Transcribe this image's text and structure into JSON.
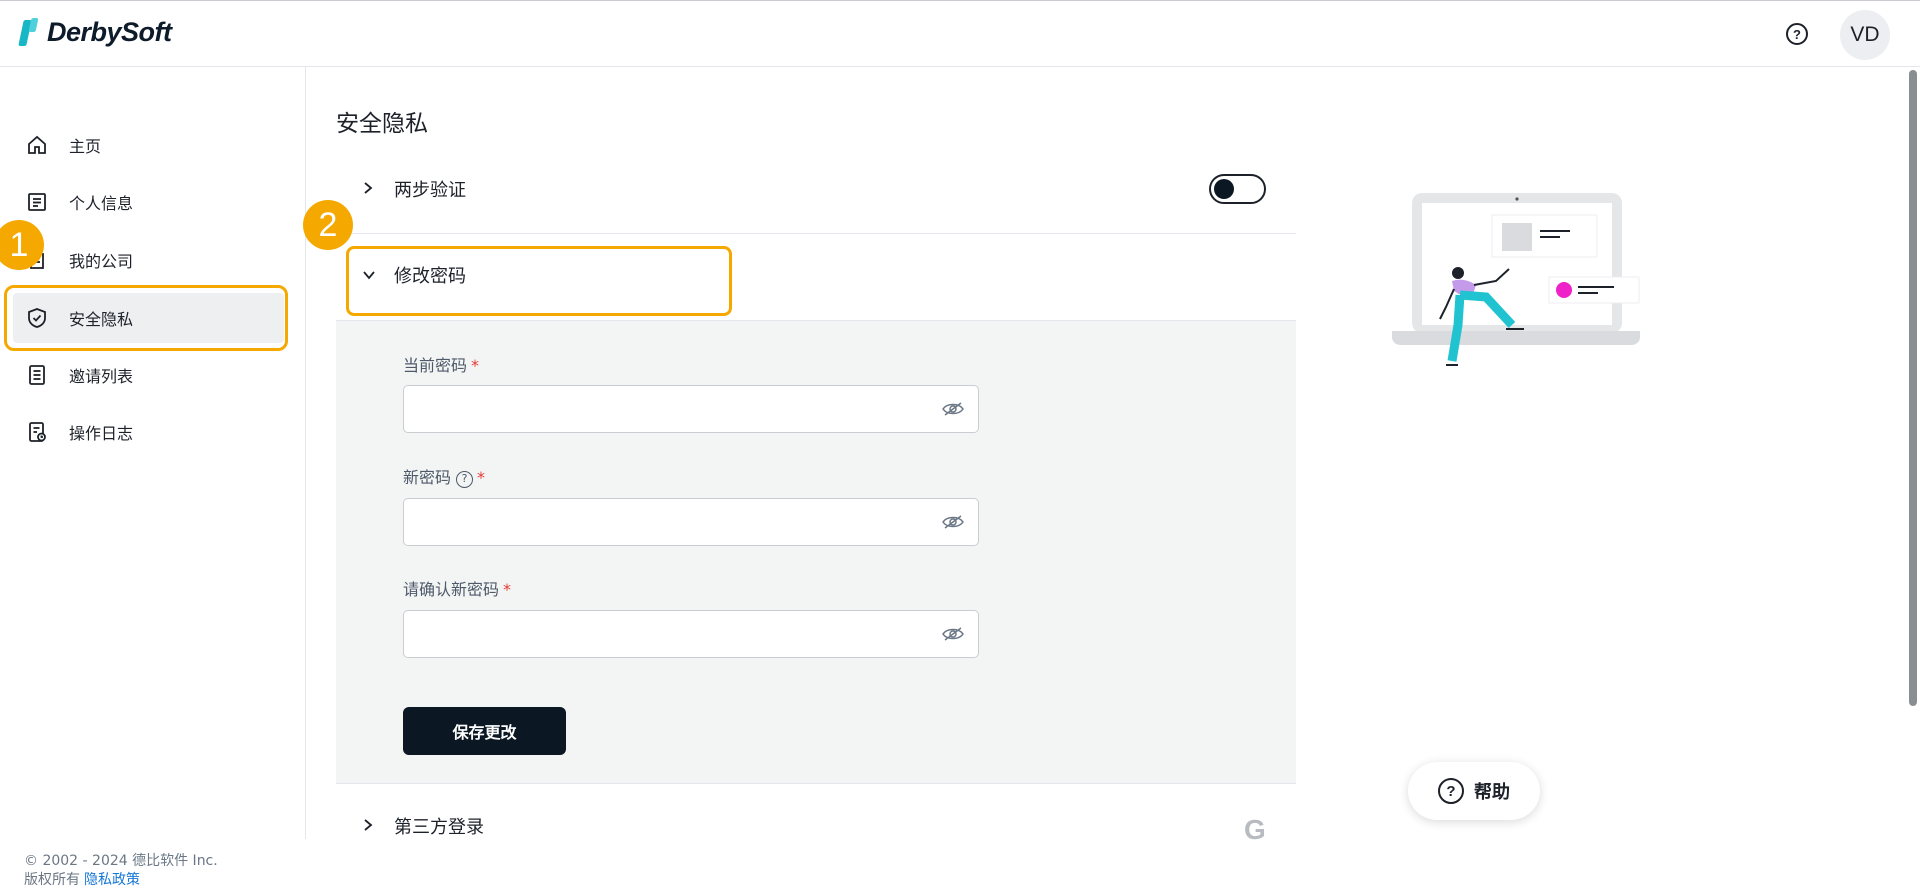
{
  "brand": {
    "name": "DerbySoft",
    "accent": "#18b7c6"
  },
  "header": {
    "help_icon": "question-circle-icon",
    "avatar_initials": "VD"
  },
  "sidebar": {
    "items": [
      {
        "label": "主页",
        "icon": "home-icon"
      },
      {
        "label": "个人信息",
        "icon": "profile-card-icon"
      },
      {
        "label": "我的公司",
        "icon": "building-icon"
      },
      {
        "label": "安全隐私",
        "icon": "shield-check-icon",
        "active": true
      },
      {
        "label": "邀请列表",
        "icon": "document-list-icon"
      },
      {
        "label": "操作日志",
        "icon": "log-icon"
      }
    ],
    "footer": {
      "copyright": "© 2002 - 2024 德比软件 Inc.",
      "rights": "版权所有",
      "privacy_link": "隐私政策"
    }
  },
  "annotations": {
    "badge1": "1",
    "badge2": "2",
    "highlight_color": "#f5a800"
  },
  "main": {
    "title": "安全隐私",
    "sections": {
      "two_step": {
        "label": "两步验证",
        "toggle_on": false
      },
      "change_password": {
        "label": "修改密码",
        "fields": [
          {
            "label": "当前密码",
            "required_mark": "*",
            "value": "",
            "has_help": false
          },
          {
            "label": "新密码",
            "required_mark": "*",
            "value": "",
            "has_help": true
          },
          {
            "label": "请确认新密码",
            "required_mark": "*",
            "value": "",
            "has_help": false
          }
        ],
        "save_label": "保存更改"
      },
      "third_party": {
        "label": "第三方登录",
        "icon": "google-icon",
        "icon_glyph": "G"
      }
    }
  },
  "help_widget": {
    "label": "帮助"
  }
}
